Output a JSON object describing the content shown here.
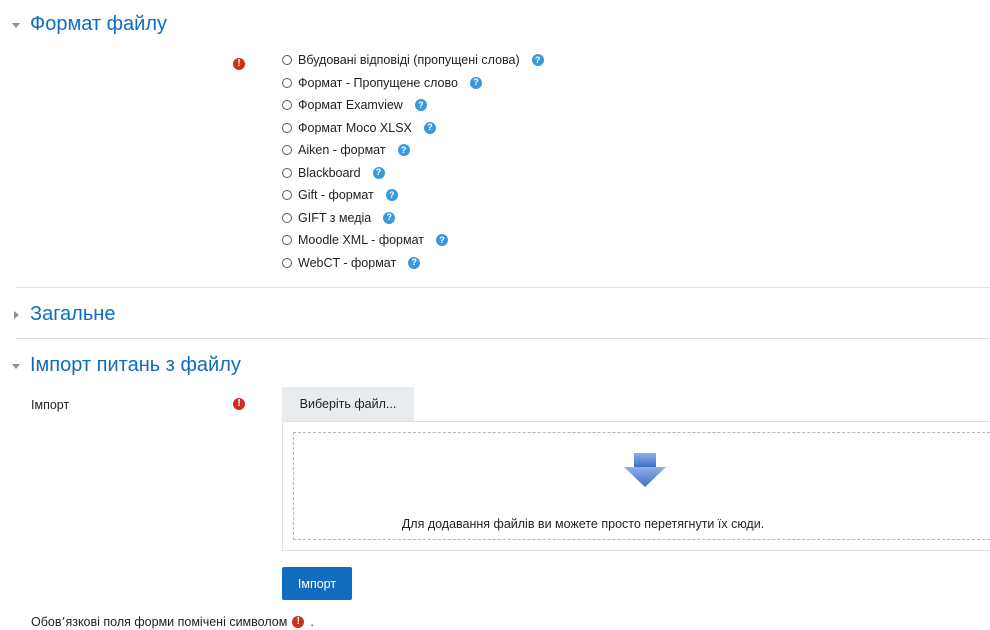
{
  "sections": {
    "file_format": {
      "title": "Формат файлу",
      "expanded": true
    },
    "general": {
      "title": "Загальне",
      "expanded": false
    },
    "import_from_file": {
      "title": "Імпорт питань з файлу",
      "expanded": true
    }
  },
  "formats": [
    {
      "label": "Вбудовані відповіді (пропущені слова)",
      "help_icon": "question-circle"
    },
    {
      "label": "Формат - Пропущене слово",
      "help_icon": "question-circle"
    },
    {
      "label": "Формат Examview",
      "help_icon": "question-circle"
    },
    {
      "label": "Формат Moco XLSX",
      "help_icon": "question-circle"
    },
    {
      "label": "Aiken - формат",
      "help_icon": "question-circle"
    },
    {
      "label": "Blackboard",
      "help_icon": "question-circle"
    },
    {
      "label": "Gift - формат",
      "help_icon": "question-circle"
    },
    {
      "label": "GIFT з медіа",
      "help_icon": "question-circle"
    },
    {
      "label": "Moodle XML - формат",
      "help_icon": "question-circle"
    },
    {
      "label": "WebCT - формат",
      "help_icon": "question-circle"
    }
  ],
  "import": {
    "label": "Імпорт",
    "choose_file_label": "Виберіть файл...",
    "drop_hint": "Для додавання файлів ви можете просто перетягнути їх сюди.",
    "submit_label": "Імпорт"
  },
  "footer": {
    "required_note": "Обов՚язкові поля форми помічені символом",
    "required_note_suffix": "."
  },
  "icons": {
    "required": "exclamation-circle",
    "help": "question-circle",
    "expanded": "triangle-down",
    "collapsed": "triangle-right",
    "drop_arrow": "arrow-down"
  },
  "colors": {
    "accent": "#0f6cbf",
    "required": "#ca3120",
    "help": "#3c98dc"
  }
}
